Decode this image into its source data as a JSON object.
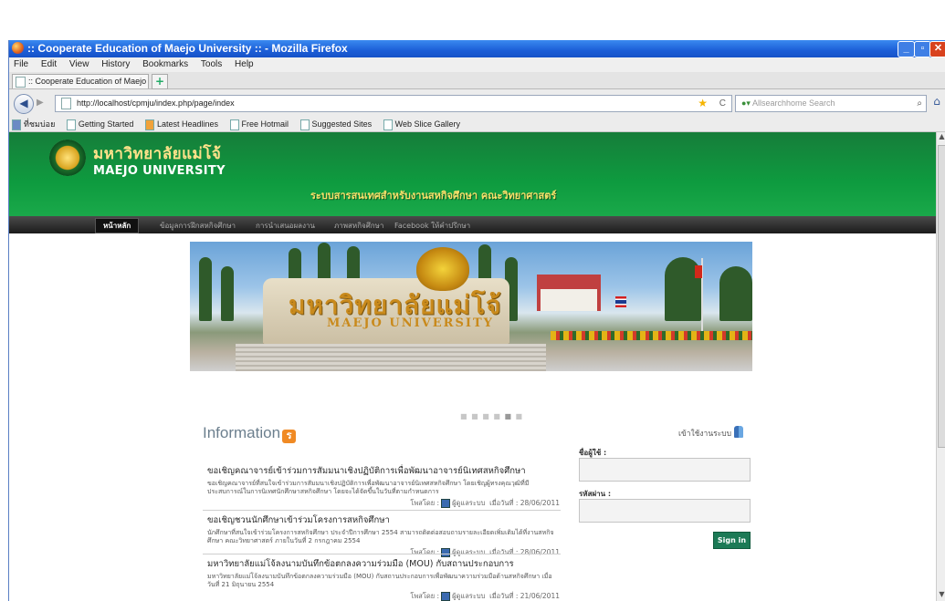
{
  "window": {
    "title": ":: Cooperate Education of Maejo University :: - Mozilla Firefox"
  },
  "menu": [
    "File",
    "Edit",
    "View",
    "History",
    "Bookmarks",
    "Tools",
    "Help"
  ],
  "tab": {
    "label": ":: Cooperate Education of Maejo University :: ",
    "new_tab": "+"
  },
  "nav": {
    "url": "http://localhost/cpmju/index.php/page/index",
    "search_placeholder": "Allsearchhome Search"
  },
  "bookmarks": [
    "ที่ชมบ่อย",
    "Getting Started",
    "Latest Headlines",
    "Free Hotmail",
    "Suggested Sites",
    "Web Slice Gallery"
  ],
  "site": {
    "name_th": "มหาวิทยาลัยแม่โจ้",
    "name_en": "MAEJO UNIVERSITY",
    "system_title": "ระบบสารสนเทศสำหรับงานสหกิจศึกษา คณะวิทยาศาสตร์",
    "nav": [
      "หน้าหลัก",
      "ข้อมูลการฝึกสหกิจศึกษา",
      "การนำเสนอผลงาน",
      "ภาพสหกิจศึกษา",
      "Facebook ให้คำปรึกษา"
    ],
    "hero_text": "มหาวิทยาลัยแม่โจ้",
    "hero_text_en": "MAEJO UNIVERSITY"
  },
  "info": {
    "heading": "Information",
    "items": [
      {
        "title": "ขอเชิญคณาจารย์เข้าร่วมการสัมมนาเชิงปฏิบัติการเพื่อพัฒนาอาจารย์นิเทศสหกิจศึกษา",
        "desc": "ขอเชิญคณาจารย์ที่สนใจเข้าร่วมการสัมมนาเชิงปฏิบัติการเพื่อพัฒนาอาจารย์นิเทศสหกิจศึกษา โดยเชิญผู้ทรงคุณวุฒิที่มีประสบการณ์ในการนิเทศนักศึกษาสหกิจศึกษา โดยจะได้จัดขึ้นในวันที่ตามกำหนดการ",
        "by_label": "โพสโดย :",
        "author": "ผู้ดูแลระบบ",
        "date_label": "เมื่อวันที่ :",
        "date": "28/06/2011"
      },
      {
        "title": "ขอเชิญชวนนักศึกษาเข้าร่วมโครงการสหกิจศึกษา",
        "desc": "นักศึกษาที่สนใจเข้าร่วมโครงการสหกิจศึกษา ประจำปีการศึกษา 2554 สามารถติดต่อสอบถามรายละเอียดเพิ่มเติมได้ที่งานสหกิจศึกษา คณะวิทยาศาสตร์ ภายในวันที่ 2 กรกฎาคม 2554",
        "by_label": "โพสโดย :",
        "author": "ผู้ดูแลระบบ",
        "date_label": "เมื่อวันที่ :",
        "date": "28/06/2011"
      },
      {
        "title": "มหาวิทยาลัยแม่โจ้ลงนามบันทึกข้อตกลงความร่วมมือ (MOU) กับสถานประกอบการ",
        "desc": "มหาวิทยาลัยแม่โจ้ลงนามบันทึกข้อตกลงความร่วมมือ (MOU) กับสถานประกอบการเพื่อพัฒนาความร่วมมือด้านสหกิจศึกษา เมื่อวันที่ 21 มิถุนายน 2554",
        "by_label": "โพสโดย :",
        "author": "ผู้ดูแลระบบ",
        "date_label": "เมื่อวันที่ :",
        "date": "21/06/2011"
      }
    ]
  },
  "login": {
    "heading": "เข้าใช้งานระบบ",
    "username_label": "ชื่อผู้ใช้ :",
    "password_label": "รหัสผ่าน :",
    "signin_label": "Sign in"
  },
  "slider": {
    "pages": 6,
    "active": 5
  },
  "colors": {
    "banner": "#0e9b3f",
    "title_yellow": "#f6e06a",
    "signin": "#1c7a56"
  }
}
